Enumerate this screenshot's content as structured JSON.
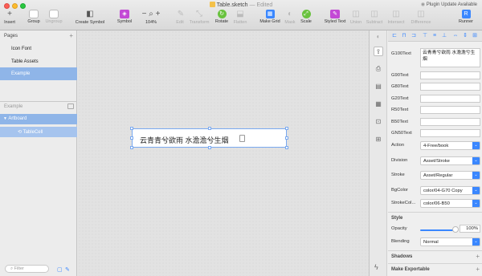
{
  "window": {
    "title": "Table.sketch",
    "edited": "— Edited",
    "update_notice": "Plugin Update Available"
  },
  "toolbar": {
    "items": [
      {
        "label": "Insert",
        "icon": "+"
      },
      {
        "label": "Group",
        "icon": "▢"
      },
      {
        "label": "Ungroup",
        "icon": "▢"
      },
      {
        "label": "Create Symbol",
        "icon": "◧"
      },
      {
        "label": "Symbol",
        "icon": "◈"
      },
      {
        "label": "104%",
        "icon": "− ⌕ +"
      },
      {
        "label": "Edit",
        "icon": "✎"
      },
      {
        "label": "Transform",
        "icon": "⤡"
      },
      {
        "label": "Rotate",
        "icon": "↻"
      },
      {
        "label": "Flatten",
        "icon": "⬓"
      },
      {
        "label": "Make Grid",
        "icon": "▦"
      },
      {
        "label": "Mask",
        "icon": "◐"
      },
      {
        "label": "Scale",
        "icon": "⤢"
      },
      {
        "label": "Styled Text",
        "icon": "✎"
      },
      {
        "label": "Union",
        "icon": "◫"
      },
      {
        "label": "Subtract",
        "icon": "◫"
      },
      {
        "label": "Intersect",
        "icon": "◫"
      },
      {
        "label": "Difference",
        "icon": "◫"
      },
      {
        "label": "Runner",
        "icon": "R"
      }
    ]
  },
  "pages": {
    "header": "Pages",
    "items": [
      "Icon Font",
      "Table Assets",
      "Example"
    ],
    "selected": "Example"
  },
  "layers": {
    "header": "Example",
    "items": [
      {
        "label": "Artboard",
        "indent": 0
      },
      {
        "label": "TableCell",
        "indent": 1
      }
    ],
    "filter_placeholder": "Filter"
  },
  "canvas": {
    "cell_text": "云青青兮欲雨 水澹澹兮生烟"
  },
  "inspector": {
    "fields": [
      {
        "label": "G100Text",
        "value": "云青青兮欲雨 水澹澹兮生烟"
      },
      {
        "label": "G90Text",
        "value": ""
      },
      {
        "label": "G80Text",
        "value": ""
      },
      {
        "label": "G20Text",
        "value": ""
      },
      {
        "label": "R50Text",
        "value": ""
      },
      {
        "label": "B50Text",
        "value": ""
      },
      {
        "label": "GN50Text",
        "value": ""
      }
    ],
    "dropdowns": [
      {
        "label": "Action",
        "value": "4-Free/book"
      },
      {
        "label": "Division",
        "value": "Asset/Stroke"
      },
      {
        "label": "Stroke",
        "value": "Asset/Regular"
      },
      {
        "label": "BgColor",
        "value": "color/04-G70 Copy"
      },
      {
        "label": "StrokeCol...",
        "value": "color/06-B50"
      }
    ],
    "style": {
      "header": "Style",
      "opacity_label": "Opacity",
      "opacity_value": "100%",
      "opacity": 1.0,
      "blending_label": "Blending",
      "blending_value": "Normal"
    },
    "sections": [
      "Shadows",
      "Make Exportable"
    ]
  },
  "colors": {
    "accent": "#3a87ff",
    "selection": "#8fb5e8"
  }
}
